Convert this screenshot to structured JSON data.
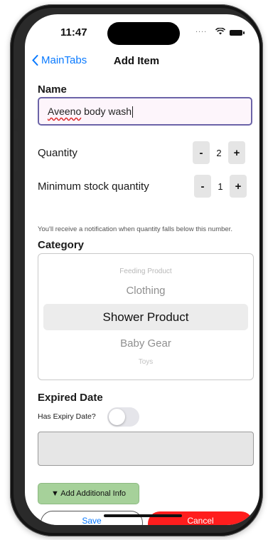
{
  "status_bar": {
    "time": "11:47",
    "dots": "....",
    "wifi_icon": "wifi-icon",
    "battery_icon": "battery-icon"
  },
  "nav": {
    "back_label": "MainTabs",
    "title": "Add Item"
  },
  "name": {
    "label": "Name",
    "value": "Aveeno body wash",
    "misspelled": "Aveeno",
    "rest": " body wash"
  },
  "quantity": {
    "label": "Quantity",
    "value": "2",
    "minus": "-",
    "plus": "+"
  },
  "min_stock": {
    "label": "Minimum stock quantity",
    "value": "1",
    "minus": "-",
    "plus": "+",
    "helper": "You'll receive a notification when quantity falls below this number."
  },
  "category": {
    "label": "Category",
    "options": [
      "Feeding Product",
      "Clothing",
      "Shower Product",
      "Baby Gear",
      "Toys"
    ],
    "selected": "Shower Product"
  },
  "expiry": {
    "label": "Expired Date",
    "toggle_label": "Has Expiry Date?",
    "toggle_on": false
  },
  "additional_info": {
    "label": "▼ Add Additional Info"
  },
  "actions": {
    "save": "Save",
    "cancel": "Cancel"
  },
  "colors": {
    "accent": "#0a7aff",
    "cancel": "#ff1d1d",
    "add_info": "#a6d19a",
    "field_border": "#6b63a8"
  }
}
